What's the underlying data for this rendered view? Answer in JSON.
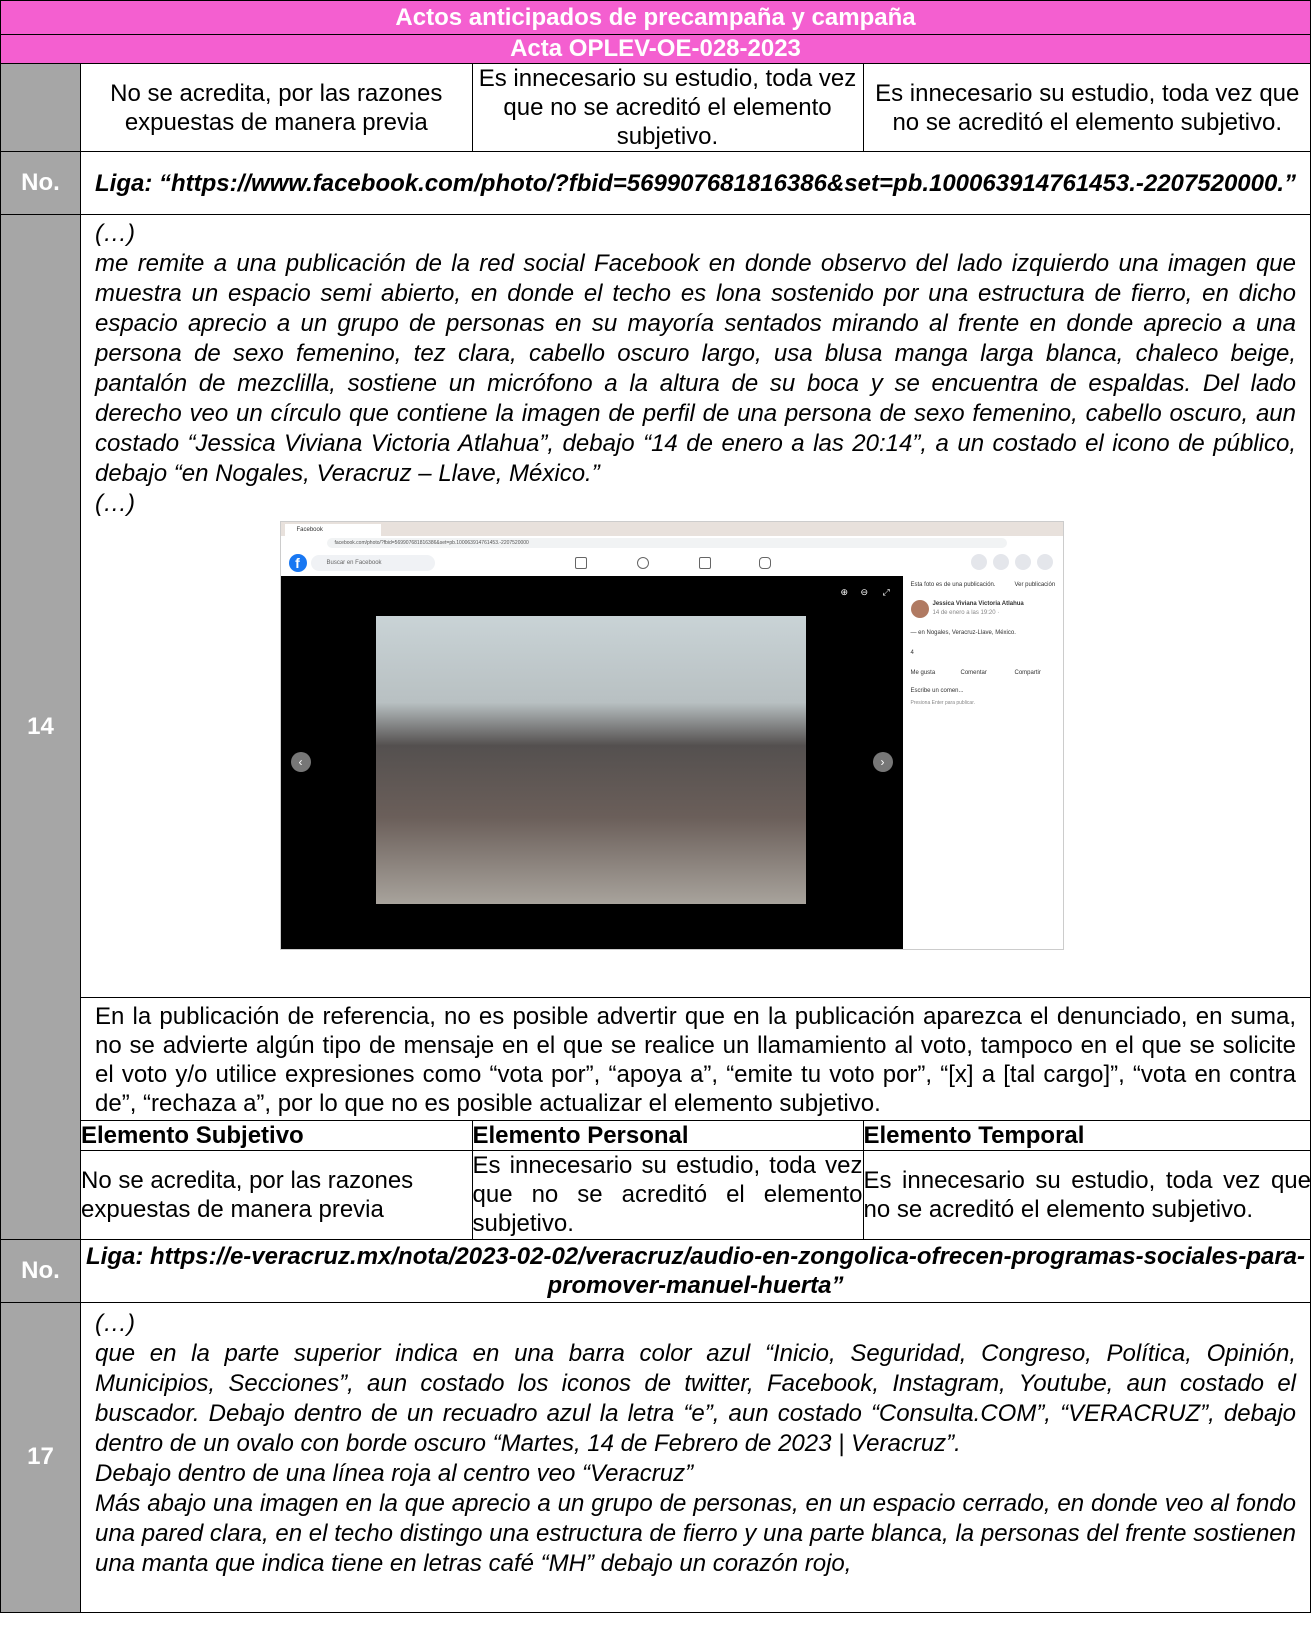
{
  "header": {
    "title": "Actos anticipados de precampaña y campaña",
    "acta": "Acta OPLEV-OE-028-2023"
  },
  "top_row": {
    "col1": "No se acredita, por las razones expuestas de manera previa",
    "col2": "Es innecesario su estudio, toda vez que no se acreditó el elemento subjetivo.",
    "col3": "Es innecesario su estudio, toda vez que no se acreditó el elemento subjetivo."
  },
  "entry14": {
    "no_label": "No.",
    "liga": "Liga: “https://www.facebook.com/photo/?fbid=569907681816386&set=pb.100063914761453.-2207520000.”",
    "number": "14",
    "ellipsis_open": "(…)",
    "text": "me remite a una publicación de la red social Facebook en donde observo del lado izquierdo una imagen que muestra un espacio semi abierto, en donde el techo es lona sostenido por una estructura de fierro, en dicho espacio aprecio a un grupo de personas en su mayoría sentados mirando al frente en donde aprecio a una persona de sexo femenino, tez clara, cabello oscuro largo, usa blusa manga larga blanca, chaleco beige, pantalón de mezclilla, sostiene un micrófono a la altura de su boca y se encuentra de espaldas. Del lado derecho veo un círculo que contiene la imagen de perfil de una persona de sexo femenino, cabello oscuro, aun costado “Jessica Viviana Victoria Atlahua”, debajo “14 de enero a las 20:14”, a un costado el icono de público, debajo “en Nogales, Veracruz – Llave, México.”",
    "ellipsis_close": "(…)",
    "screenshot": {
      "tab_label": "Facebook",
      "url": "facebook.com/photo/?fbid=569907681816386&set=pb.100063914761453.-2207520000",
      "search_placeholder": "Buscar en Facebook",
      "side_notice": "Esta foto es de una publicación.",
      "side_link": "Ver publicación",
      "author": "Jessica Viviana Victoria Atlahua",
      "date": "14 de enero a las 19:20 · ",
      "location": "— en Nogales, Veracruz-Llave, México.",
      "reactions": "4",
      "like": "Me gusta",
      "comment": "Comentar",
      "share": "Compartir",
      "comment_placeholder": "Escribe un comen...",
      "enter_hint": "Presiona Enter para publicar."
    },
    "analysis": "En la publicación de referencia, no es posible advertir que en la publicación aparezca el denunciado, en suma, no se advierte algún tipo de mensaje en el que se realice un llamamiento al voto, tampoco en el que se solicite el voto y/o utilice expresiones como “vota por”, “apoya a”, “emite tu voto por”, “[x] a [tal cargo]”, “vota en contra de”, “rechaza a”, por lo que no es posible actualizar el elemento subjetivo.",
    "elements": {
      "h1": "Elemento Subjetivo",
      "h2": "Elemento Personal",
      "h3": "Elemento Temporal",
      "v1": "No se acredita, por las razones expuestas de manera previa",
      "v2": "Es innecesario su estudio, toda vez que no se acreditó el elemento subjetivo.",
      "v3": "Es innecesario su estudio, toda vez que no se acreditó el elemento subjetivo."
    }
  },
  "entry17": {
    "no_label": "No.",
    "liga": "Liga: https://e-veracruz.mx/nota/2023-02-02/veracruz/audio-en-zongolica-ofrecen-programas-sociales-para-promover-manuel-huerta”",
    "number": "17",
    "ellipsis_open": "(…)",
    "p1": "que en la parte superior indica en una barra color azul “Inicio, Seguridad, Congreso, Política, Opinión, Municipios, Secciones”, aun costado los iconos de twitter, Facebook, Instagram, Youtube, aun costado el buscador. Debajo dentro de un recuadro azul la letra “e”, aun costado “Consulta.COM”, “VERACRUZ”, debajo dentro de un ovalo con borde oscuro “Martes, 14 de Febrero de 2023 | Veracruz”.",
    "p2": "Debajo dentro de una línea roja al centro veo “Veracruz”",
    "p3": "Más abajo una imagen en la que aprecio a un grupo de personas, en un espacio cerrado, en donde veo al fondo una pared clara, en el techo distingo una estructura de fierro y una parte blanca, la personas del frente sostienen una manta que indica tiene en letras café “MH” debajo un corazón rojo,"
  }
}
